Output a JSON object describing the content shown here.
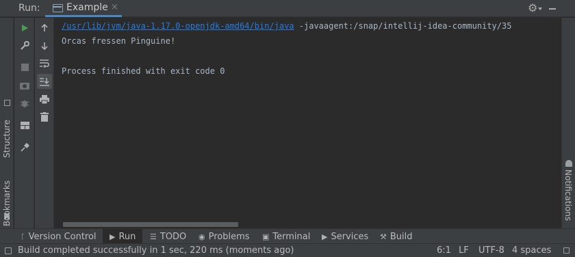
{
  "header": {
    "run_label": "Run:",
    "tab_label": "Example",
    "tab_close": "×",
    "settings_icon": "gear-icon",
    "minimize_icon": "minimize-icon"
  },
  "left_strip": {
    "structure_label": "Structure",
    "bookmarks_label": "Bookmarks"
  },
  "right_strip": {
    "notifications_label": "Notifications"
  },
  "toolbar1": {
    "icons": [
      "rerun-icon",
      "modify-config-icon",
      "stop-icon",
      "screenshot-icon",
      "debug-icon",
      "layout-icon",
      "pin-icon"
    ]
  },
  "toolbar2": {
    "icons": [
      "up-arrow-icon",
      "down-arrow-icon",
      "soft-wrap-icon",
      "scroll-to-end-icon",
      "print-icon",
      "trash-icon"
    ]
  },
  "console": {
    "command_path": "/usr/lib/jvm/java-1.17.0-openjdk-amd64/bin/java",
    "command_args": " -javaagent:/snap/intellij-idea-community/35",
    "output_line": "Orcas fressen Pinguine!",
    "exit_line": "Process finished with exit code 0"
  },
  "bottom_tabs": {
    "version_control": "Version Control",
    "run": "Run",
    "todo": "TODO",
    "problems": "Problems",
    "terminal": "Terminal",
    "services": "Services",
    "build": "Build"
  },
  "status": {
    "message": "Build completed successfully in 1 sec, 220 ms (moments ago)",
    "position": "6:1",
    "line_separator": "LF",
    "encoding": "UTF-8",
    "indent": "4 spaces"
  },
  "colors": {
    "panel": "#3c3f41",
    "editor": "#2b2b2b",
    "link": "#287bde",
    "accent_tab": "#4a88c7",
    "run_green": "#499c54"
  }
}
